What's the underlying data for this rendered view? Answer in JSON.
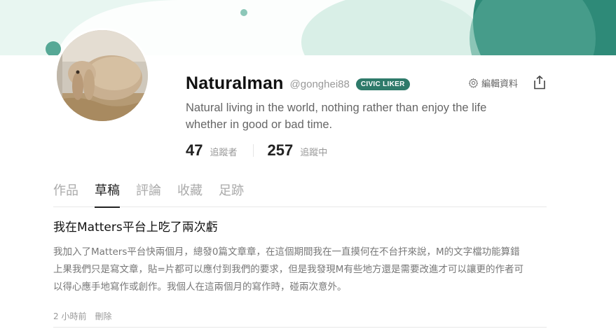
{
  "profile": {
    "display_name": "Naturalman",
    "handle": "@gonghei88",
    "badge": "CIVIC LIKER",
    "bio_line1": "Natural living in the world, nothing rather than enjoy the life",
    "bio_line2": "whether in good or bad time.",
    "followers_count": "47",
    "followers_label": "追蹤者",
    "following_count": "257",
    "following_label": "追蹤中"
  },
  "actions": {
    "edit_profile_label": "編輯資料",
    "edit_icon": "gear-icon",
    "share_icon": "share-icon"
  },
  "tabs": [
    {
      "label": "作品",
      "active": false
    },
    {
      "label": "草稿",
      "active": true
    },
    {
      "label": "評論",
      "active": false
    },
    {
      "label": "收藏",
      "active": false
    },
    {
      "label": "足跡",
      "active": false
    }
  ],
  "drafts": [
    {
      "title": "我在Matters平台上吃了兩次虧",
      "summary_line1": "我加入了Matters平台快兩個月，總發0篇文章章，在這個期間我在一直摸何在不台扞來說，M的文字檔功能算錯",
      "summary_line2": "上果我們只是寫文章，貼=片都可以應付到我們的要求，但是我發現M有些地方還是需要改進才可以讓更的作者可",
      "summary_line3": "以得心應手地寫作或創作。我個人在這兩個月的寫作時，碰兩次意外。",
      "time": "2 小時前",
      "delete_label": "刪除"
    }
  ],
  "colors": {
    "banner_bg": "#e8f6f1",
    "banner_accent": "#2e8a78",
    "badge_bg": "#2e7a6a"
  }
}
